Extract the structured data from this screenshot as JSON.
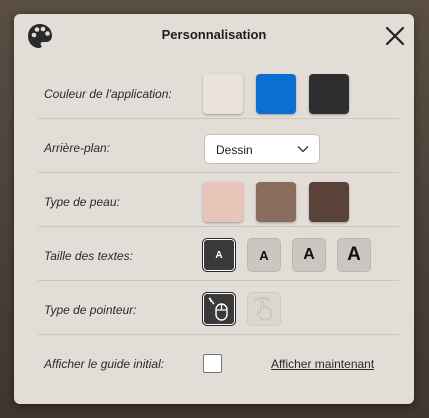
{
  "dialog": {
    "title": "Personnalisation",
    "logo_icon": "palette-icon",
    "close_icon": "close-icon"
  },
  "app_color": {
    "label": "Couleur de l'application:",
    "swatches": [
      "#e9e3d9",
      "#0a6fd1",
      "#2e2e2e"
    ]
  },
  "background": {
    "label": "Arrière-plan:",
    "selected": "Dessin"
  },
  "skin_type": {
    "label": "Type de peau:",
    "swatches": [
      "#e8c5b8",
      "#8a6c5c",
      "#5a4238"
    ]
  },
  "text_size": {
    "label": "Taille des textes:",
    "options": [
      "A",
      "A",
      "A",
      "A"
    ],
    "selected_index": 0
  },
  "pointer_type": {
    "label": "Type de pointeur:",
    "options": [
      "mouse-icon",
      "touch-hand-icon"
    ],
    "selected_index": 0
  },
  "guide": {
    "label": "Afficher le guide initial:",
    "checked": false,
    "link": "Afficher maintenant"
  }
}
